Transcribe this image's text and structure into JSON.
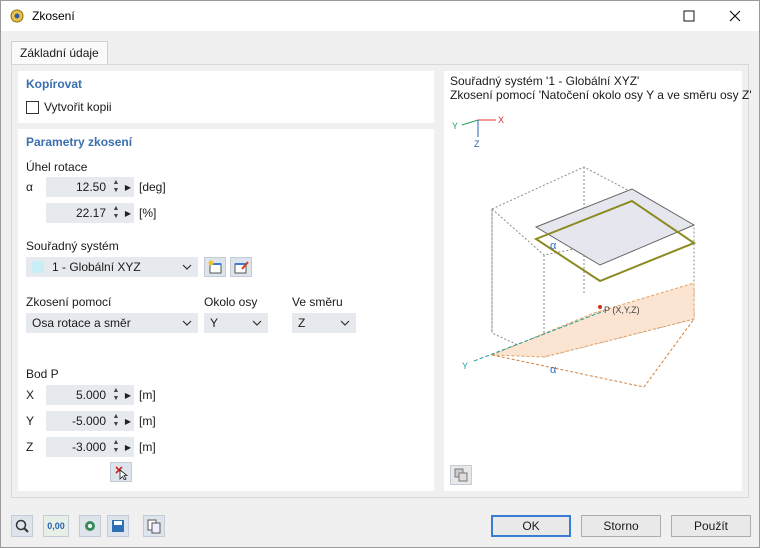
{
  "window": {
    "title": "Zkosení"
  },
  "tabs": [
    {
      "label": "Základní údaje"
    }
  ],
  "copy_section": {
    "title": "Kopírovat",
    "create_copy_label": "Vytvořit kopii",
    "create_copy_checked": false
  },
  "params": {
    "title": "Parametry zkosení",
    "rotation_angle_label": "Úhel rotace",
    "alpha_symbol": "α",
    "alpha_deg": {
      "value": "12.50",
      "unit": "[deg]"
    },
    "alpha_pct": {
      "value": "22.17",
      "unit": "[%]"
    },
    "coord_system_label": "Souřadný systém",
    "coord_system_value": "1 - Globální XYZ",
    "skew_by_label": "Zkosení pomocí",
    "skew_by_value": "Osa rotace a směr",
    "about_axis_label": "Okolo osy",
    "about_axis_value": "Y",
    "direction_label": "Ve směru",
    "direction_value": "Z",
    "point_label": "Bod P",
    "point": [
      {
        "axis": "X",
        "value": "5.000",
        "unit": "[m]"
      },
      {
        "axis": "Y",
        "value": "-5.000",
        "unit": "[m]"
      },
      {
        "axis": "Z",
        "value": "-3.000",
        "unit": "[m]"
      }
    ]
  },
  "preview": {
    "line1": "Souřadný systém '1 - Globální XYZ'",
    "line2": "Zkosení pomocí 'Natočení okolo osy Y a ve směru osy Z'",
    "axis_x": "X",
    "axis_y": "Y",
    "axis_z": "Z",
    "alpha": "α",
    "point_label": "P (X,Y,Z)",
    "y_axis_label": "Y"
  },
  "footer": {
    "ok": "OK",
    "cancel": "Storno",
    "apply": "Použít",
    "counter": "0,00"
  },
  "colors": {
    "accent": "#3a6fb0",
    "skew_plane": "#8a8a20",
    "plane_fill": "#e8e8f0",
    "ground": "#f5b070"
  }
}
